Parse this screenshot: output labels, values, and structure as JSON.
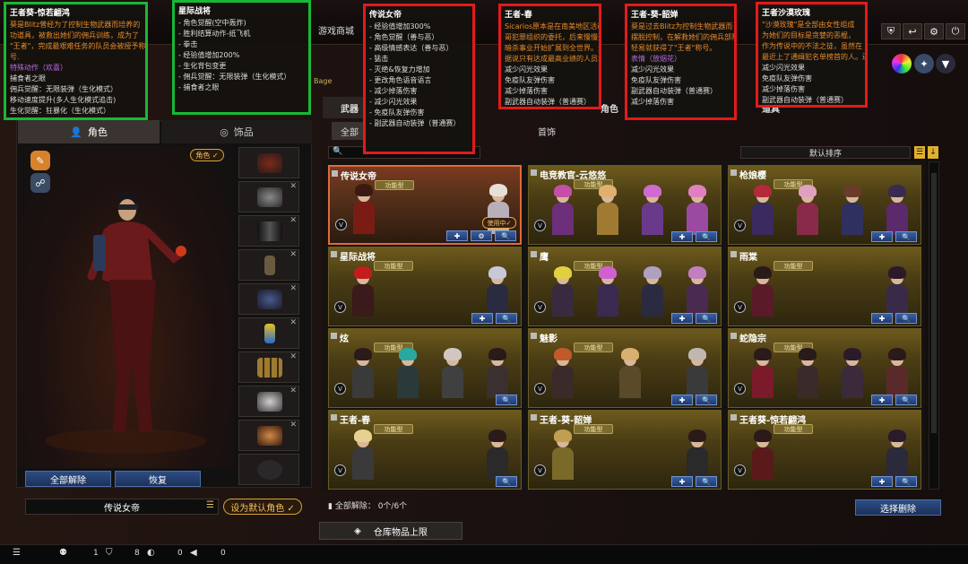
{
  "topbar": {
    "nav": [
      "游戏商城"
    ],
    "ticker": "Bage"
  },
  "left": {
    "tabs": {
      "character": "角色",
      "accessory": "饰品"
    },
    "role_tag": "角色 ✓",
    "buttons": {
      "release_all": "全部解除",
      "restore": "恢复"
    },
    "name_input": "传说女帝",
    "default_btn": "设为默认角色 ✓"
  },
  "right": {
    "tabs": {
      "weapon": "武器",
      "role": "角色",
      "item": "道具"
    },
    "subtabs": {
      "all": "全部",
      "accessory": "首饰"
    },
    "sort": "默认排序",
    "footer": "全部解除：  0个/6个",
    "batch_btn": "选择删除",
    "warehouse": "仓库物品上限"
  },
  "cards": [
    {
      "name": "传说女帝",
      "badge": "功能型",
      "selected": true,
      "using": "使用中✓",
      "portraits": [
        {
          "hair": "#3a1a12",
          "body": "#7a1c14"
        },
        {
          "hair": "#e8e0d8",
          "body": "#b8b0b8"
        }
      ],
      "actions": [
        "✚",
        "⚙",
        "🔍"
      ]
    },
    {
      "name": "电竞教官-云悠悠",
      "badge": "功能型",
      "portraits": [
        {
          "hair": "#c54fa8",
          "body": "#6d2f7a"
        },
        {
          "hair": "#e0b070",
          "body": "#a07a30"
        },
        {
          "hair": "#d06ad0",
          "body": "#6a3a8a"
        },
        {
          "hair": "#e080c0",
          "body": "#9a4aa0"
        }
      ],
      "actions": [
        "✚",
        "🔍"
      ]
    },
    {
      "name": "枪娘樱",
      "badge": "功能型",
      "portraits": [
        {
          "hair": "#b42a3a",
          "body": "#3a2a60"
        },
        {
          "hair": "#e0a0c0",
          "body": "#8a2a4a"
        },
        {
          "hair": "#6a3a2a",
          "body": "#303060"
        },
        {
          "hair": "#3a2a50",
          "body": "#5a2a6a"
        }
      ],
      "actions": [
        "✚",
        "🔍"
      ]
    },
    {
      "name": "星际战将",
      "badge": "功能型",
      "portraits": [
        {
          "hair": "#c41c1c",
          "body": "#3a1a1a"
        },
        {
          "hair": "#c8c8d8",
          "body": "#2a2a40"
        }
      ],
      "actions": [
        "✚",
        "🔍"
      ]
    },
    {
      "name": "鹰",
      "badge": "功能型",
      "portraits": [
        {
          "hair": "#e0d040",
          "body": "#3a2a40"
        },
        {
          "hair": "#d060d0",
          "body": "#3a2a50"
        },
        {
          "hair": "#b0a0c0",
          "body": "#2a2a40"
        },
        {
          "hair": "#c080c0",
          "body": "#4a2a50"
        }
      ],
      "actions": [
        "✚",
        "🔍"
      ]
    },
    {
      "name": "雨棠",
      "badge": "功能型",
      "portraits": [
        {
          "hair": "#2a1a1a",
          "body": "#5a1a2a"
        },
        {
          "hair": "#2a1a2a",
          "body": "#3a2a4a"
        }
      ],
      "actions": [
        "✚",
        "🔍"
      ]
    },
    {
      "name": "炫",
      "badge": "功能型",
      "portraits": [
        {
          "hair": "#2a1a1a",
          "body": "#3a3a3a"
        },
        {
          "hair": "#2aa8a0",
          "body": "#2a3a3a"
        },
        {
          "hair": "#d0c8c0",
          "body": "#404040"
        },
        {
          "hair": "#2a1a1a",
          "body": "#3a3030"
        }
      ],
      "actions": [
        "🔍"
      ]
    },
    {
      "name": "魅影",
      "badge": "功能型",
      "portraits": [
        {
          "hair": "#c05a2a",
          "body": "#3a2a2a"
        },
        {
          "hair": "#d8b070",
          "body": "#5a4a2a"
        },
        {
          "hair": "#c0b8b0",
          "body": "#3a3a3a"
        }
      ],
      "actions": [
        "✚",
        "🔍"
      ]
    },
    {
      "name": "蛇隐宗",
      "badge": "功能型",
      "portraits": [
        {
          "hair": "#2a1a1a",
          "body": "#7a1a2a"
        },
        {
          "hair": "#2a1a1a",
          "body": "#3a2a2a"
        },
        {
          "hair": "#2a1a2a",
          "body": "#3a2a3a"
        },
        {
          "hair": "#2a1a1a",
          "body": "#5a2a2a"
        }
      ],
      "actions": [
        "✚",
        "🔍"
      ]
    },
    {
      "name": "王者-春",
      "badge": "功能型",
      "portraits": [
        {
          "hair": "#e8d090",
          "body": "#3a3a3a"
        },
        {
          "hair": "#2a1a1a",
          "body": "#2a2a2a"
        }
      ],
      "actions": [
        "🔍"
      ]
    },
    {
      "name": "王者-葵-韶婵",
      "badge": "功能型",
      "portraits": [
        {
          "hair": "#c0a050",
          "body": "#7a6a2a"
        },
        {
          "hair": "#2a1a1a",
          "body": "#2a2a2a"
        }
      ],
      "actions": [
        "✚",
        "🔍"
      ]
    },
    {
      "name": "王者葵-惊若翩鸿",
      "badge": "功能型",
      "portraits": [
        {
          "hair": "#2a1a1a",
          "body": "#5a1a1a"
        },
        {
          "hair": "#2a1a2a",
          "body": "#2a2a3a"
        }
      ],
      "actions": [
        "✚",
        "🔍"
      ]
    }
  ],
  "status": {
    "a": "1",
    "b": "8",
    "c": "0",
    "d": "0"
  },
  "overlays": [
    {
      "title": "王者葵-惊若翩鸿",
      "color": "green",
      "lines": [
        {
          "t": "葵是Blitz曾经为了控制生物武器而培养的",
          "c": "o"
        },
        {
          "t": "功道具，被救出她们的佣兵训练，成为了",
          "c": "o"
        },
        {
          "t": "\"王者\"，完成最艰难任务的队员会被授予称",
          "c": "o"
        },
        {
          "t": "号.",
          "c": "o"
        },
        {
          "t": "特殊动作（欢喜）",
          "c": "p"
        },
        {
          "t": "捕食者之眼",
          "c": ""
        },
        {
          "t": "佣兵觉醒：无限装弹（生化模式）",
          "c": ""
        },
        {
          "t": "移动速度提升(多人生化模式追击)",
          "c": ""
        },
        {
          "t": "生化觉醒：狂暴化（生化模式）",
          "c": ""
        }
      ]
    },
    {
      "title": "星际战将",
      "color": "green",
      "lines": [
        {
          "t": "- 角色觉醒(空中轰炸)",
          "c": ""
        },
        {
          "t": "- 胜利结算动作-纸飞机",
          "c": ""
        },
        {
          "t": "- 拳击",
          "c": ""
        },
        {
          "t": "- 经验值增加200%",
          "c": ""
        },
        {
          "t": "- 生化背包变更",
          "c": ""
        },
        {
          "t": "- 佣兵觉醒：无限装弹（生化模式）",
          "c": ""
        },
        {
          "t": "- 捕食者之眼",
          "c": ""
        }
      ]
    },
    {
      "title": "传说女帝",
      "color": "red",
      "lines": [
        {
          "t": "- 经验值增加300%",
          "c": ""
        },
        {
          "t": "- 角色觉醒（善与恶）",
          "c": ""
        },
        {
          "t": "- 高级情感表达（善与恶）",
          "c": ""
        },
        {
          "t": "- 猛击",
          "c": ""
        },
        {
          "t": "- 灭绝&恢复力增加",
          "c": ""
        },
        {
          "t": "- 更改角色语音语言",
          "c": ""
        },
        {
          "t": "- 减少掉落伤害",
          "c": ""
        },
        {
          "t": "- 减少闪光效果",
          "c": ""
        },
        {
          "t": "- 免疫队友弹伤害",
          "c": ""
        },
        {
          "t": "- 副武器自动装弹（普通赛）",
          "c": ""
        }
      ]
    },
    {
      "title": "王者-春",
      "color": "red",
      "lines": [
        {
          "t": "Sicarios原本是在南美地区活动的",
          "c": "o"
        },
        {
          "t": "哥犯罪组织的委托，后来慢慢开始",
          "c": "o"
        },
        {
          "t": "暗杀事业开始扩展到全世界。最",
          "c": "o"
        },
        {
          "t": "据说只有达成最高业绩的人员才",
          "c": "o"
        },
        {
          "t": "减少闪光效果",
          "c": ""
        },
        {
          "t": "免疫队友弹伤害",
          "c": ""
        },
        {
          "t": "减少掉落伤害",
          "c": ""
        },
        {
          "t": "副武器自动装弹（普通赛）",
          "c": ""
        }
      ]
    },
    {
      "title": "王者-葵-韶婵",
      "color": "red",
      "lines": [
        {
          "t": "葵是过去Blitz为控制生物武器而",
          "c": "o"
        },
        {
          "t": "摆脱控制，在解救她们的佣兵部队",
          "c": "o"
        },
        {
          "t": "轻易就获得了\"王者\"称号。",
          "c": "o"
        },
        {
          "t": "",
          "c": ""
        },
        {
          "t": "表情（放烟花）",
          "c": "p"
        },
        {
          "t": "减少闪光效果",
          "c": ""
        },
        {
          "t": "免疫队友弹伤害",
          "c": ""
        },
        {
          "t": "副武器自动装弹（普通赛）",
          "c": ""
        },
        {
          "t": "减少掉落伤害",
          "c": ""
        }
      ]
    },
    {
      "title": "王者沙漠玫瑰",
      "color": "red",
      "lines": [
        {
          "t": "\"沙漠玫瑰\"是全部由女性组成",
          "c": "o"
        },
        {
          "t": "为她们的目标是贪婪的恶棍，",
          "c": "o"
        },
        {
          "t": "作为传说中的不法之徒，虽然在",
          "c": "o"
        },
        {
          "t": "最近上了通缉犯名单榜首的人。还",
          "c": "o"
        },
        {
          "t": "减少闪光效果",
          "c": ""
        },
        {
          "t": "免疫队友弹伤害",
          "c": ""
        },
        {
          "t": "减少掉落伤害",
          "c": ""
        },
        {
          "t": "副武器自动装弹（普通赛）",
          "c": ""
        }
      ]
    }
  ]
}
